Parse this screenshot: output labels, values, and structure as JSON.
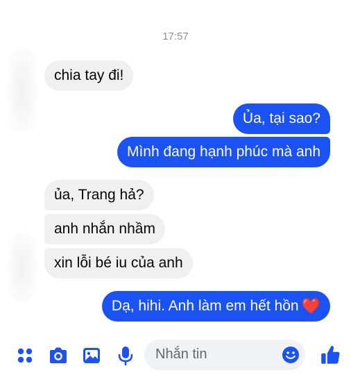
{
  "conversation": {
    "timestamp": "17:57",
    "messages": [
      {
        "side": "in",
        "text": "chia tay đi!"
      },
      {
        "side": "out",
        "text": "Ủa, tại sao?"
      },
      {
        "side": "out",
        "text": "Mình đang hạnh phúc mà anh"
      },
      {
        "side": "in",
        "text": "ủa, Trang hả?"
      },
      {
        "side": "in",
        "text": "anh nhắn nhầm"
      },
      {
        "side": "in",
        "text": "xin lỗi bé iu của anh"
      },
      {
        "side": "out",
        "text": "Dạ, hihi. Anh làm em hết hồn",
        "emoji": "❤️"
      }
    ]
  },
  "composer": {
    "placeholder": "Nhắn tin",
    "icons": [
      "apps-icon",
      "camera-icon",
      "gallery-icon",
      "microphone-icon",
      "emoji-icon",
      "thumbs-up-icon"
    ]
  },
  "colors": {
    "outgoing_bubble": "#1b52f4",
    "incoming_bubble": "#f0f0f0",
    "accent": "#1b52f4"
  }
}
